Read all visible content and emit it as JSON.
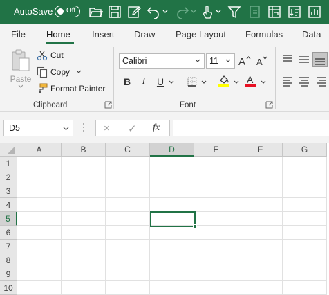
{
  "titlebar": {
    "autosave_label": "AutoSave",
    "autosave_state": "Off",
    "accent": "#217346"
  },
  "tabs": [
    {
      "label": "File"
    },
    {
      "label": "Home"
    },
    {
      "label": "Insert"
    },
    {
      "label": "Draw"
    },
    {
      "label": "Page Layout"
    },
    {
      "label": "Formulas"
    },
    {
      "label": "Data"
    }
  ],
  "ribbon": {
    "clipboard": {
      "paste_label": "Paste",
      "cut_label": "Cut",
      "copy_label": "Copy",
      "format_painter_label": "Format Painter",
      "group_label": "Clipboard"
    },
    "font": {
      "font_name": "Calibri",
      "font_size": "11",
      "bold": "B",
      "italic": "I",
      "underline": "U",
      "group_label": "Font",
      "highlight_color": "#ffff00",
      "font_color": "#e81123"
    }
  },
  "formula_bar": {
    "name_box": "D5",
    "cancel_icon": "×",
    "enter_icon": "✓",
    "fx_label": "fx",
    "formula_value": ""
  },
  "grid": {
    "columns": [
      "A",
      "B",
      "C",
      "D",
      "E",
      "F",
      "G"
    ],
    "rows": [
      "1",
      "2",
      "3",
      "4",
      "5",
      "6",
      "7",
      "8",
      "9",
      "10"
    ],
    "active_column": "D",
    "active_row": "5"
  }
}
